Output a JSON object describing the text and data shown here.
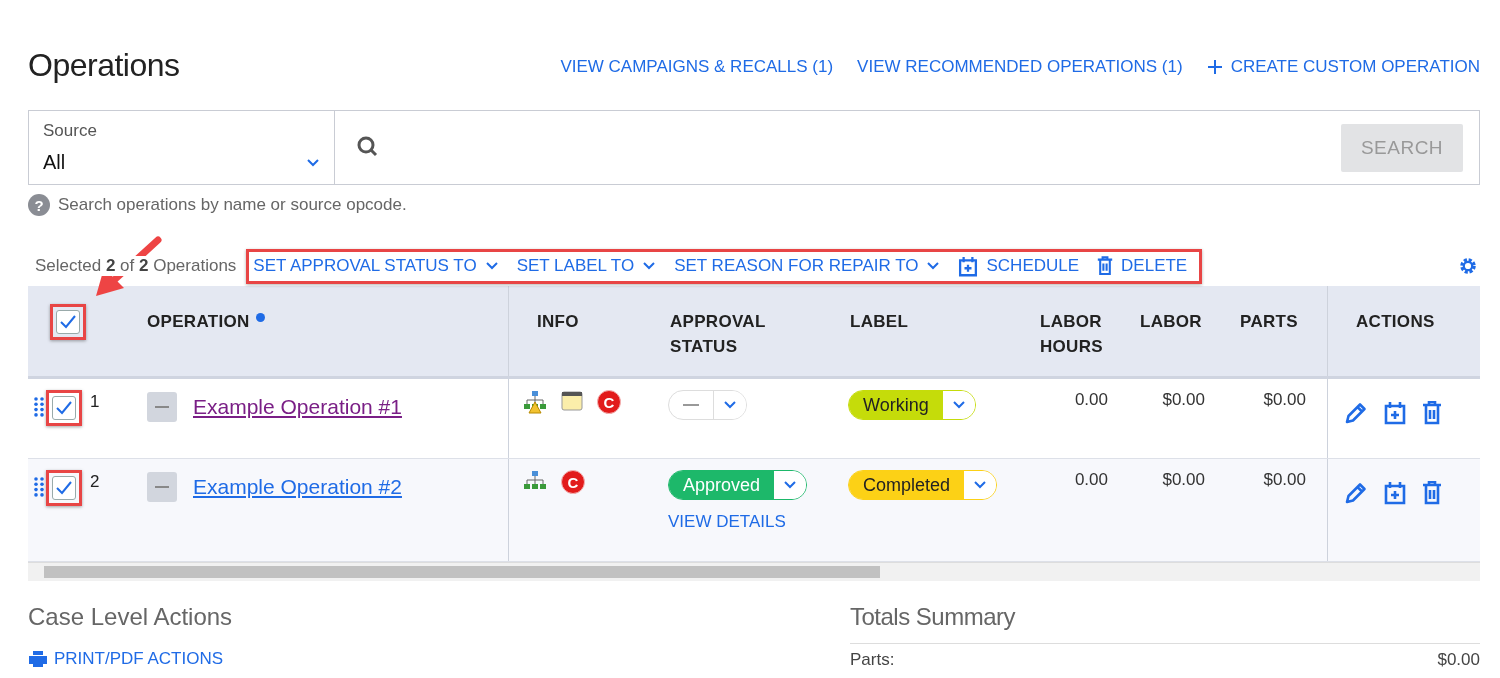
{
  "page": {
    "title": "Operations",
    "links": [
      {
        "label": "VIEW CAMPAIGNS & RECALLS (1)",
        "kind": "link"
      },
      {
        "label": "VIEW RECOMMENDED OPERATIONS (1)",
        "kind": "link"
      },
      {
        "label": "CREATE CUSTOM OPERATION",
        "kind": "create"
      }
    ]
  },
  "search": {
    "source_label": "Source",
    "source_value": "All",
    "button": "SEARCH",
    "button_disabled": true,
    "hint_icon": "?",
    "hint": "Search operations by name or source opcode."
  },
  "selection": {
    "summary": "Selected **2** of **2** Operations",
    "highlighted": true,
    "actions": [
      {
        "label": "SET APPROVAL STATUS TO",
        "kind": "dropdown"
      },
      {
        "label": "SET LABEL TO",
        "kind": "dropdown"
      },
      {
        "label": "SET REASON FOR REPAIR TO",
        "kind": "dropdown"
      },
      {
        "label": "SCHEDULE",
        "kind": "schedule"
      },
      {
        "label": "DELETE",
        "kind": "delete"
      }
    ]
  },
  "table": {
    "all_checked": true,
    "all_highlighted": true,
    "columns": [
      "OPERATION",
      "INFO",
      "APPROVAL STATUS",
      "LABEL",
      "LABOR HOURS",
      "LABOR",
      "PARTS",
      "ACTIONS"
    ],
    "rows": [
      {
        "number": "1",
        "checked": true,
        "highlighted": true,
        "name": "Example Operation #1",
        "visited": true,
        "info": [
          {
            "kind": "hierarchy-warning"
          },
          {
            "kind": "notes"
          },
          {
            "kind": "campaign",
            "text": "C"
          }
        ],
        "approval": {
          "kind": "none"
        },
        "label": {
          "text": "Working",
          "color": "#c5dc0a"
        },
        "labor_hours": "0.00",
        "labor": "$0.00",
        "parts": "$0.00"
      },
      {
        "number": "2",
        "checked": true,
        "highlighted": true,
        "name": "Example Operation #2",
        "visited": false,
        "info": [
          {
            "kind": "hierarchy"
          },
          {
            "kind": "campaign",
            "text": "C"
          }
        ],
        "approval": {
          "kind": "status",
          "text": "Approved",
          "color": "#1db86a",
          "details": "VIEW DETAILS"
        },
        "label": {
          "text": "Completed",
          "color": "#fcd116"
        },
        "labor_hours": "0.00",
        "labor": "$0.00",
        "parts": "$0.00"
      }
    ]
  },
  "case_actions": {
    "title": "Case Level Actions",
    "links": [
      {
        "label": "PRINT/PDF ACTIONS",
        "kind": "print"
      }
    ]
  },
  "totals": {
    "title": "Totals Summary",
    "rows": [
      {
        "label": "Parts:",
        "value": "$0.00"
      }
    ]
  }
}
